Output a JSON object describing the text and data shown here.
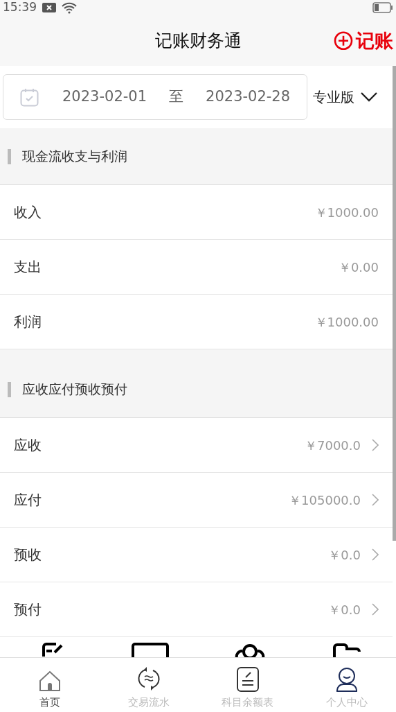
{
  "status_bar": {
    "time": "15:39"
  },
  "header": {
    "title": "记账财务通",
    "action": "记账"
  },
  "date_range": {
    "start": "2023-02-01",
    "separator": "至",
    "end": "2023-02-28"
  },
  "edition": {
    "label": "专业版"
  },
  "sections": [
    {
      "title": "现金流收支与利润",
      "rows": [
        {
          "label": "收入",
          "value": "￥1000.00",
          "chevron": false
        },
        {
          "label": "支出",
          "value": "￥0.00",
          "chevron": false
        },
        {
          "label": "利润",
          "value": "￥1000.00",
          "chevron": false
        }
      ]
    },
    {
      "title": "应收应付预收预付",
      "rows": [
        {
          "label": "应收",
          "value": "￥7000.0",
          "chevron": true
        },
        {
          "label": "应付",
          "value": "￥105000.0",
          "chevron": true
        },
        {
          "label": "预收",
          "value": "￥0.0",
          "chevron": true
        },
        {
          "label": "预付",
          "value": "￥0.0",
          "chevron": true
        }
      ]
    }
  ],
  "bottom_nav": [
    {
      "label": "首页",
      "kind": "home",
      "selected": true
    },
    {
      "label": "交易流水",
      "kind": "flow",
      "selected": false
    },
    {
      "label": "科目余额表",
      "kind": "ledger",
      "selected": false
    },
    {
      "label": "个人中心",
      "kind": "user",
      "selected": false
    }
  ]
}
